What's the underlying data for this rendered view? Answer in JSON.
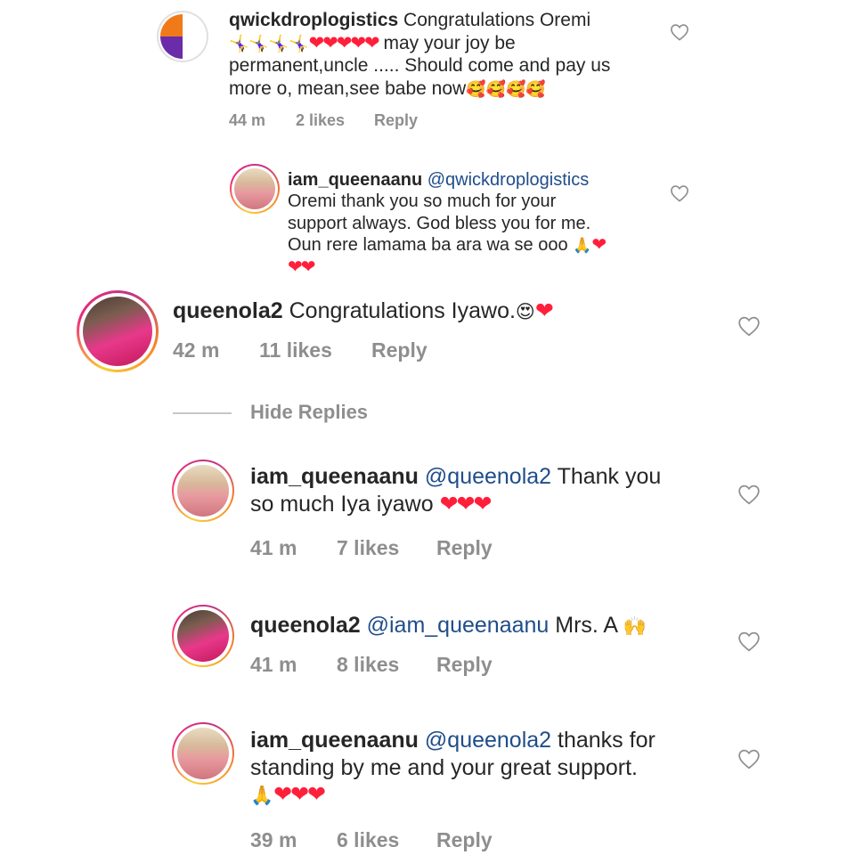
{
  "comments": [
    {
      "user": "qwickdroplogistics",
      "text_pre": "Congratulations Oremi",
      "emoji_line1": "🤸‍♀️🤸‍♀️🤸‍♀️🤸‍♀️",
      "hearts1": "❤❤❤❤❤",
      "text_mid": " may your joy be",
      "text_line2": "permanent,uncle ..... Should come and pay us",
      "text_line3": "more o, mean,see babe now",
      "emoji_end": "🥰🥰🥰🥰",
      "time": "44 m",
      "likes": "2 likes",
      "reply": "Reply"
    },
    {
      "user": "iam_queenaanu",
      "mention": "@qwickdroplogistics",
      "line1": "Oremi thank you so much for your",
      "line2": "support always. God bless you for me.",
      "line3": "Oun rere lamama ba ara wa se ooo ",
      "emoji3": "🙏",
      "hearts3": "❤",
      "hearts4": "❤❤"
    },
    {
      "user": "queenola2",
      "text": "Congratulations Iyawo.",
      "emoji": "😍",
      "hearts": "❤",
      "time": "42 m",
      "likes": "11 likes",
      "reply": "Reply"
    }
  ],
  "hide_replies": "Hide Replies",
  "replies": [
    {
      "user": "iam_queenaanu",
      "mention": "@queenola2",
      "text1": " Thank you",
      "text2": "so much Iya iyawo ",
      "hearts": "❤❤❤",
      "time": "41 m",
      "likes": "7 likes",
      "reply": "Reply"
    },
    {
      "user": "queenola2",
      "mention": "@iam_queenaanu",
      "text1": " Mrs. A ",
      "emoji": "🙌",
      "time": "41 m",
      "likes": "8 likes",
      "reply": "Reply"
    },
    {
      "user": "iam_queenaanu",
      "mention": "@queenola2",
      "text1": " thanks for",
      "text2": "standing by me and your great support.",
      "emoji": "🙏",
      "hearts": "❤❤❤",
      "time": "39 m",
      "likes": "6 likes",
      "reply": "Reply"
    }
  ],
  "icons": {
    "like": "heart-outline-icon"
  },
  "colors": {
    "mention": "#1f4d8b",
    "meta": "#8e8e8e",
    "heart": "#ff1f3b"
  }
}
